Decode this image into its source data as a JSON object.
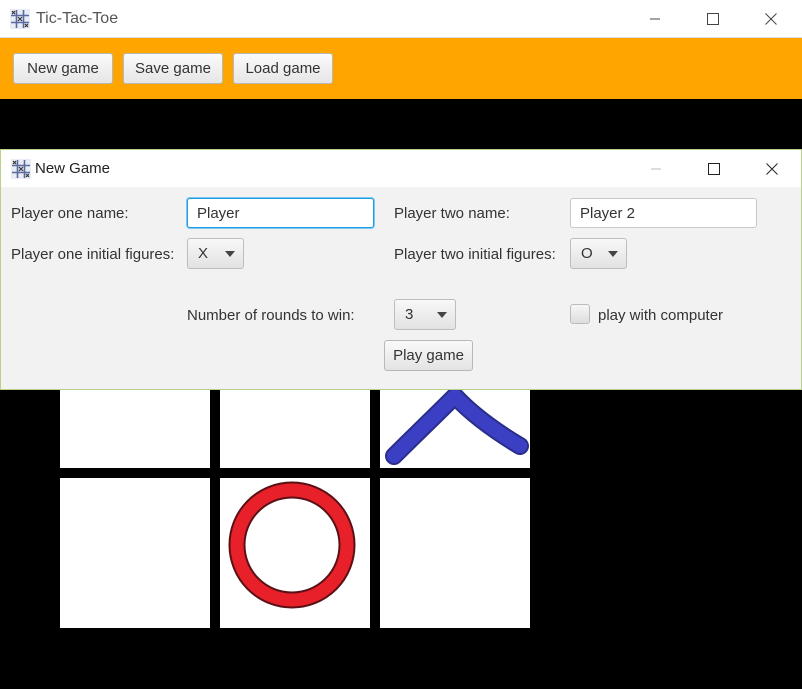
{
  "main_window": {
    "title": "Tic-Tac-Toe",
    "toolbar": {
      "new_game": "New game",
      "save_game": "Save game",
      "load_game": "Load game"
    },
    "accent_color": "#ffa500"
  },
  "board": {
    "cells": [
      [
        "",
        "",
        "X"
      ],
      [
        "",
        "O",
        ""
      ]
    ],
    "x_color": "#3b3fc4",
    "o_color": "#e8202a"
  },
  "dialog": {
    "title": "New Game",
    "player_one_label": "Player one name:",
    "player_one_value": "Player",
    "player_two_label": "Player two name:",
    "player_two_value": "Player 2",
    "p1_figures_label": "Player one initial figures:",
    "p1_figures_value": "X",
    "p2_figures_label": "Player two initial figures:",
    "p2_figures_value": "O",
    "rounds_label": "Number of rounds to win:",
    "rounds_value": "3",
    "computer_label": "play with computer",
    "computer_checked": false,
    "play_button": "Play game"
  },
  "icons": {
    "app_icon": "tic-tac-toe-grid-icon",
    "minimize": "minimize-icon",
    "maximize": "maximize-icon",
    "close": "close-icon"
  }
}
